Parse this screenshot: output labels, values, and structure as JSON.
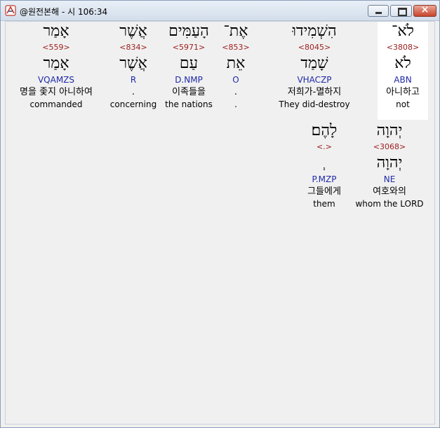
{
  "window": {
    "title": "@원전본해 - 시 106:34",
    "buttons": {
      "minimize": "minimize",
      "maximize": "maximize",
      "close": "×"
    }
  },
  "rows": [
    {
      "words": [
        {
          "hebrew": "לֹא־",
          "strong": "<3808>",
          "lemma": "לֹא",
          "morph": "ABN",
          "korean": "아니하고",
          "english": "not",
          "highlight": true
        },
        {
          "hebrew": "הִשְׁמִידוּ",
          "strong": "<8045>",
          "lemma": "שָׁמַד",
          "morph": "VHACZP",
          "korean": "저희가-멸하지",
          "english": "They did-destroy",
          "highlight": false
        },
        {
          "hebrew": "אֶת־",
          "strong": "<853>",
          "lemma": "אֵת",
          "morph": "O",
          "korean": ".",
          "english": ".",
          "highlight": false
        },
        {
          "hebrew": "הָעַמִּים",
          "strong": "<5971>",
          "lemma": "עַם",
          "morph": "D.NMP",
          "korean": "이족들을",
          "english": "the nations",
          "highlight": false
        },
        {
          "hebrew": "אֲשֶׁר",
          "strong": "<834>",
          "lemma": "אֲשֶׁר",
          "morph": "R",
          "korean": ".",
          "english": "concerning",
          "highlight": false
        },
        {
          "hebrew": "אָמַר",
          "strong": "<559>",
          "lemma": "אָמַר",
          "morph": "VQAMZS",
          "korean": "명을 좇지 아니하여",
          "english": "commanded",
          "highlight": false
        }
      ]
    },
    {
      "words": [
        {
          "hebrew": "יְהוָה",
          "strong": "<3068>",
          "lemma": "יְהוָה",
          "morph": "NE",
          "korean": "여호와의",
          "english": "whom the LORD",
          "highlight": false
        },
        {
          "hebrew": "לָהֶם׃",
          "strong": "<.>",
          "lemma": "ְ",
          "morph": "P.MZP",
          "korean": "그들에게",
          "english": "them",
          "highlight": false
        }
      ]
    }
  ]
}
